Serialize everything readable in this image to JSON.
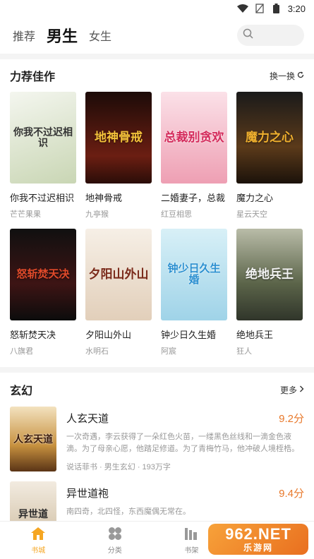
{
  "status": {
    "time": "3:20"
  },
  "nav": {
    "tabs": [
      "推荐",
      "男生",
      "女生"
    ],
    "active": "男生"
  },
  "recommend": {
    "title": "力荐佳作",
    "action": "换一换",
    "books": [
      {
        "title": "你我不过迟相识",
        "author": "芒芒果果",
        "cover_text": "你我不过迟相识",
        "cover_color": "#e9ece4"
      },
      {
        "title": "地神骨戒",
        "author": "九亭猴",
        "cover_text": "地神骨戒",
        "cover_color": "#3a1510"
      },
      {
        "title": "二婚妻子，总裁",
        "author": "红豆相思",
        "cover_text": "总裁别贪欢",
        "cover_color": "#f3b7c6"
      },
      {
        "title": "魔力之心",
        "author": "星云天空",
        "cover_text": "魔力之心",
        "cover_color": "#2a1e14"
      },
      {
        "title": "怒斩焚天决",
        "author": "八旗君",
        "cover_text": "怒斩焚天决",
        "cover_color": "#201010"
      },
      {
        "title": "夕阳山外山",
        "author": "水明石",
        "cover_text": "夕阳山外山",
        "cover_color": "#efe3d4"
      },
      {
        "title": "钟少日久生婚",
        "author": "阿宸",
        "cover_text": "钟少日久生婚",
        "cover_color": "#bfe3f0"
      },
      {
        "title": "绝地兵王",
        "author": "狂人",
        "cover_text": "绝地兵王",
        "cover_color": "#586048"
      }
    ]
  },
  "fantasy": {
    "title": "玄幻",
    "action": "更多",
    "books": [
      {
        "title": "人玄天道",
        "score": "9.2分",
        "desc": "一次奇遇，李云获得了一朵红色火苗，一缕黑色丝线和一滴金色液滴。为了母亲心愿，他踏足修道。为了青梅竹马，他冲破人境桎梏。",
        "meta": "说话菲书 · 男生玄幻 · 193万字",
        "cover_text": "人玄天道",
        "cover_color": "#c88a3e"
      },
      {
        "title": "异世道袍",
        "score": "9.4分",
        "desc": "南四奇，北四怪，东西魔偶无常在。",
        "meta": "",
        "cover_text": "异世道",
        "cover_color": "#d9cbb5"
      }
    ]
  },
  "bottom_nav": [
    {
      "label": "书城",
      "icon": "home-icon"
    },
    {
      "label": "分类",
      "icon": "category-icon"
    },
    {
      "label": "书架",
      "icon": "bookshelf-icon"
    }
  ],
  "watermark": {
    "line1": "962.NET",
    "line2": "乐游网"
  },
  "colors": {
    "accent": "#f5a623",
    "score": "#e8782a"
  }
}
